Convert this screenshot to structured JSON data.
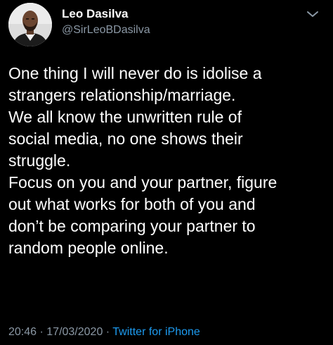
{
  "user": {
    "name": "Leo Dasilva",
    "handle": "@SirLeoBDasilva"
  },
  "tweet": {
    "lines": [
      "One thing I will never do is idolise a",
      "strangers relationship/marriage.",
      "We all know the unwritten rule of",
      "social media, no one shows their",
      "struggle.",
      "Focus on you and your partner, figure",
      "out what works for both of you and",
      "don’t be comparing your partner to",
      "random people online."
    ]
  },
  "meta": {
    "time": "20:46",
    "separator1": " · ",
    "date": "17/03/2020",
    "separator2": " · ",
    "source": "Twitter for iPhone"
  },
  "colors": {
    "background": "#000000",
    "text": "#ffffff",
    "secondary": "#8b98a5",
    "link": "#1d9bf0"
  },
  "icons": {
    "avatar": "profile-photo",
    "menu": "chevron-down-icon"
  }
}
